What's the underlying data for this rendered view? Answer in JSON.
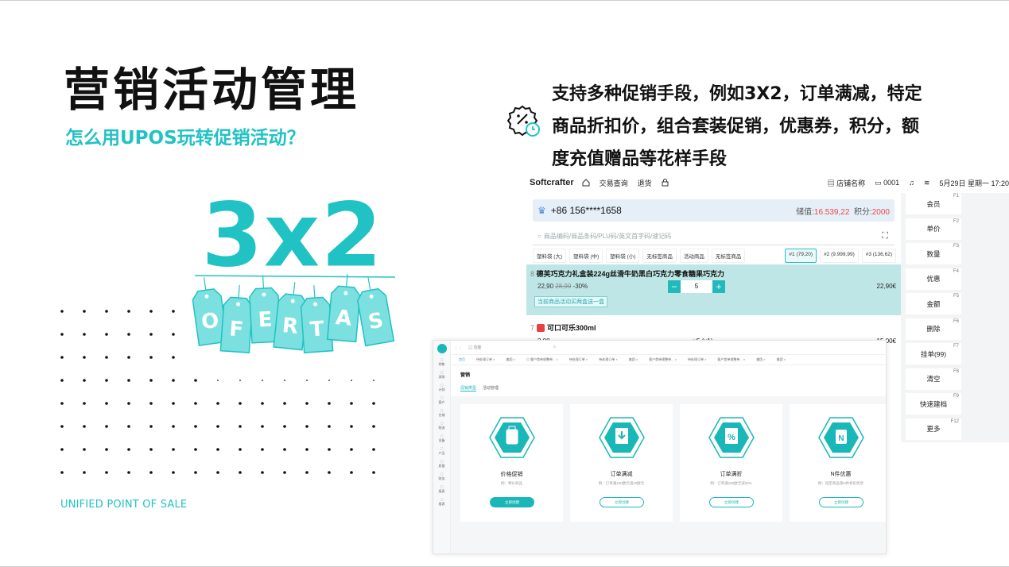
{
  "title": "营销活动管理",
  "subtitle": "怎么用UPOS玩转促销活动？",
  "tagline": "UNIFIED POINT OF SALE",
  "hero": {
    "big_text": "3x2",
    "letters": [
      "O",
      "F",
      "E",
      "R",
      "T",
      "A",
      "S"
    ],
    "color": "#21c2c4"
  },
  "description": {
    "lines": [
      "支持多种促销手段，例如3X2，订单满减，特定",
      "商品折扣价，组合套装促销，优惠券，积分，额",
      "度充值赠品等花样手段"
    ],
    "icon": "discount-clock-icon"
  },
  "pos": {
    "logo": "Softcrafter",
    "menu": [
      "交易查询",
      "退货"
    ],
    "store": "店铺名称",
    "terminal": "0001",
    "datetime": "5月29日  星期一  17:20",
    "member_phone": "+86  156****1658",
    "balance_label": "储值:",
    "balance": "16.539,22",
    "points_label": "积分:",
    "points": "2000",
    "search_placeholder": "商品编码/商品条码/PLU码/英文首字码/速记码",
    "chips": [
      "塑料袋 (大)",
      "塑料袋 (中)",
      "塑料袋 (小)",
      "无标签商品",
      "活动商品",
      "无标签商品"
    ],
    "scales": [
      "#1 (79,20)",
      "#2 (9.999,99)",
      "#3 (136,62)"
    ],
    "items": [
      {
        "index": "8",
        "name": "德芙巧克力礼盒装224g丝滑牛奶黑白巧克力零食糖果巧克力",
        "price": "22,90",
        "original": "28,90",
        "discount": "-30%",
        "qty": "5",
        "total": "22,90€",
        "promo": "当前商品活动买两盒送一盒"
      },
      {
        "index": "7",
        "name": "可口可乐300ml",
        "price": "3,00",
        "qty": "x5 (x1)",
        "total": "15,00€"
      }
    ],
    "fkeys": [
      {
        "key": "F1",
        "label": "会员"
      },
      {
        "key": "F2",
        "label": "单价"
      },
      {
        "key": "F3",
        "label": "数量"
      },
      {
        "key": "F4",
        "label": "优惠"
      },
      {
        "key": "F5",
        "label": "金额"
      },
      {
        "key": "F6",
        "label": "删除"
      },
      {
        "key": "F7",
        "label": "挂单(99)"
      },
      {
        "key": "F8",
        "label": "清空"
      },
      {
        "key": "F9",
        "label": "快速建档"
      },
      {
        "key": "F12",
        "label": "更多"
      }
    ]
  },
  "admin": {
    "search_placeholder": "功能",
    "tabs": [
      "首页",
      "待处理订单 ×",
      "美团 ×",
      "⊙ 客户首单规整单... ×",
      "待处理订单 ×",
      "待处理订单 ×",
      "美团 ×",
      "客户首单规整单... ×",
      "待处理订单 ×",
      "客户首单规整单... ×",
      "美团 ×",
      "美团 ×"
    ],
    "nav": [
      "销售",
      "采购",
      "计划",
      "客户",
      "仓储",
      "物流",
      "设备",
      "产品",
      "质量",
      "财务",
      "报表",
      "报表"
    ],
    "heading": "营销",
    "subtabs": [
      "促销类型",
      "活动管理"
    ],
    "cards": [
      {
        "title": "价格促销",
        "desc": "例：特价商品",
        "button": "立即创建",
        "icon": "bag-icon"
      },
      {
        "title": "订单满减",
        "desc": "例：订单满100欧元减10欧元",
        "button": "立即创建",
        "icon": "download-doc-icon"
      },
      {
        "title": "订单满折",
        "desc": "例：订单满100欧元减20%",
        "button": "立即创建",
        "icon": "percent-doc-icon"
      },
      {
        "title": "N件优惠",
        "desc": "例：指定商品第N件折扣优享",
        "button": "立即创建",
        "icon": "n-bag-icon"
      }
    ]
  }
}
